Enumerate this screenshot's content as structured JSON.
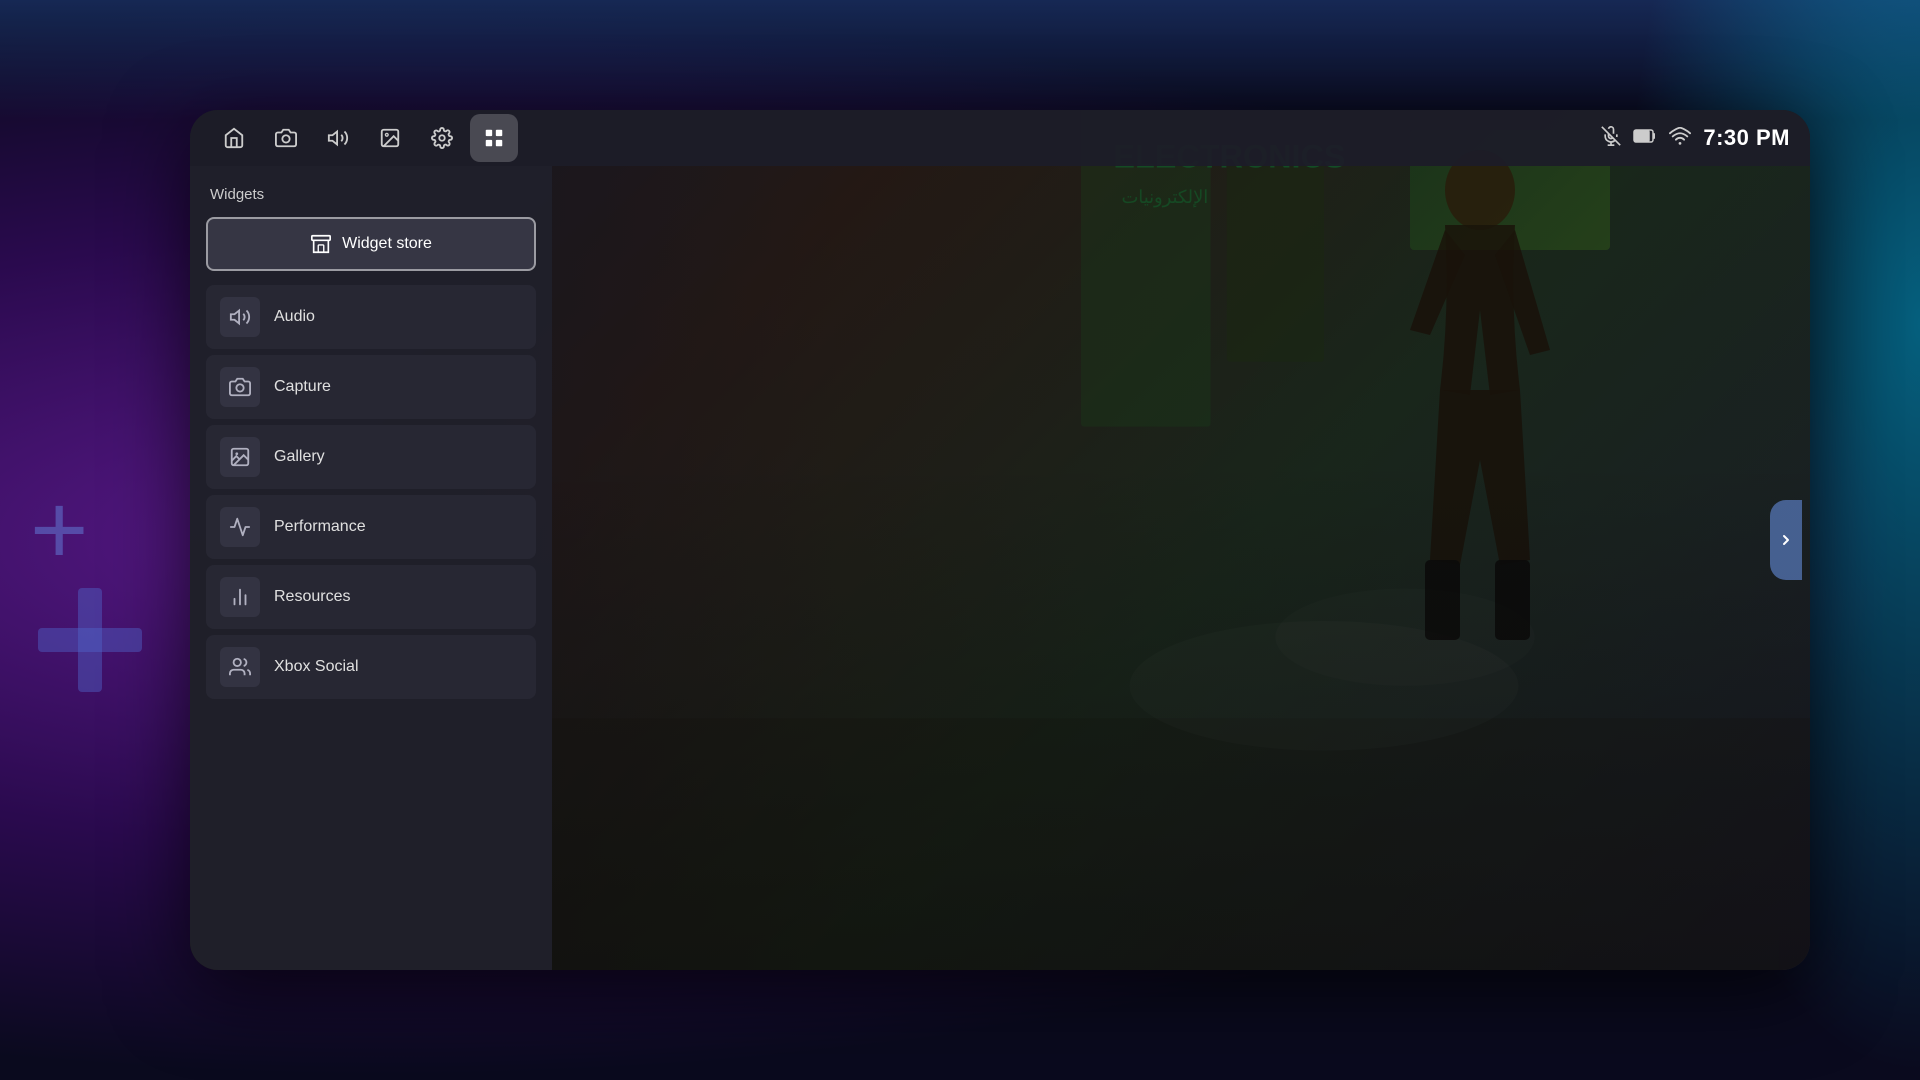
{
  "background": {
    "colors": {
      "outer_bg": "#1a0a2e",
      "device_bg": "#1c1c2e",
      "panel_bg": "rgba(32,32,42,0.97)"
    }
  },
  "status_bar": {
    "time": "7:30 PM",
    "icons": {
      "mic_muted": "🎤",
      "battery": "🔋",
      "wifi": "📶"
    }
  },
  "nav": {
    "items": [
      {
        "id": "home",
        "label": "Home",
        "icon": "home"
      },
      {
        "id": "capture",
        "label": "Capture",
        "icon": "camera"
      },
      {
        "id": "audio",
        "label": "Audio",
        "icon": "volume"
      },
      {
        "id": "gallery",
        "label": "Gallery",
        "icon": "gallery"
      },
      {
        "id": "settings",
        "label": "Settings",
        "icon": "gear"
      },
      {
        "id": "widgets",
        "label": "Widgets",
        "icon": "grid",
        "active": true
      }
    ]
  },
  "widgets_panel": {
    "title": "Widgets",
    "store_button": {
      "label": "Widget store",
      "icon": "store"
    },
    "items": [
      {
        "id": "audio",
        "label": "Audio",
        "icon": "volume"
      },
      {
        "id": "capture",
        "label": "Capture",
        "icon": "camera"
      },
      {
        "id": "gallery",
        "label": "Gallery",
        "icon": "gallery"
      },
      {
        "id": "performance",
        "label": "Performance",
        "icon": "chart"
      },
      {
        "id": "resources",
        "label": "Resources",
        "icon": "bar-chart"
      },
      {
        "id": "xbox-social",
        "label": "Xbox Social",
        "icon": "people"
      }
    ]
  }
}
